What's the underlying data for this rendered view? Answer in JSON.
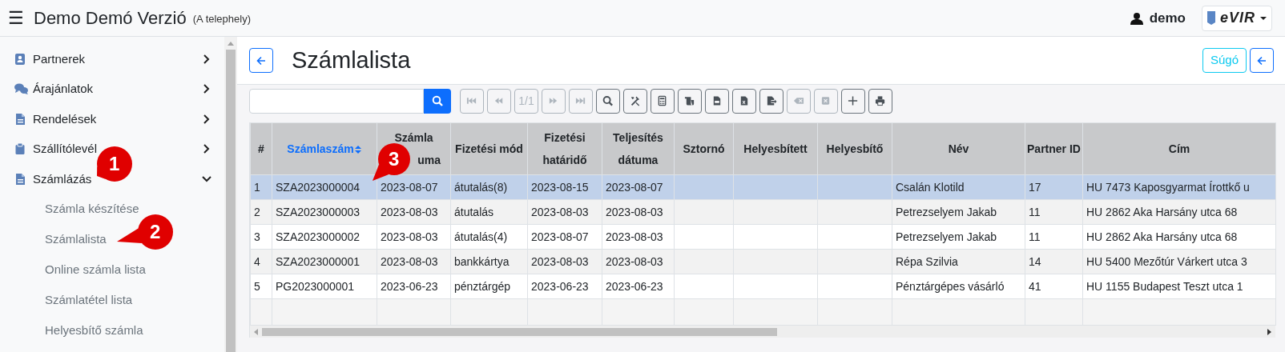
{
  "topbar": {
    "menu_glyph": "☰",
    "title": "Demo Demó Verzió",
    "subtitle": "(A telephely)",
    "user": "demo",
    "logo": "eVIR"
  },
  "sidebar": {
    "items": [
      {
        "label": "Partnerek",
        "expanded": false
      },
      {
        "label": "Árajánlatok",
        "expanded": false
      },
      {
        "label": "Rendelések",
        "expanded": false
      },
      {
        "label": "Szállítólevél",
        "expanded": false
      },
      {
        "label": "Számlázás",
        "expanded": true,
        "children": [
          {
            "label": "Számla készítése"
          },
          {
            "label": "Számlalista"
          },
          {
            "label": "Online számla lista"
          },
          {
            "label": "Számlatétel lista"
          },
          {
            "label": "Helyesbítő számla"
          }
        ]
      }
    ]
  },
  "page": {
    "title": "Számlalista",
    "help_button": "Súgó"
  },
  "toolbar": [
    {
      "kind": "first",
      "disabled": true
    },
    {
      "kind": "prev",
      "disabled": true
    },
    {
      "kind": "page",
      "label": "1/1",
      "disabled": true
    },
    {
      "kind": "next",
      "disabled": true
    },
    {
      "kind": "last",
      "disabled": true
    },
    {
      "kind": "search",
      "disabled": false
    },
    {
      "kind": "tools",
      "disabled": false
    },
    {
      "kind": "calculator",
      "disabled": false
    },
    {
      "kind": "scroll",
      "disabled": false
    },
    {
      "kind": "csv",
      "disabled": false
    },
    {
      "kind": "xls",
      "disabled": false
    },
    {
      "kind": "export",
      "disabled": false
    },
    {
      "kind": "erase",
      "disabled": true
    },
    {
      "kind": "delete",
      "disabled": true
    },
    {
      "kind": "add",
      "disabled": false
    },
    {
      "kind": "print",
      "disabled": false
    }
  ],
  "table": {
    "columns": [
      {
        "label": "#",
        "sorted": false
      },
      {
        "label": "Számlaszám",
        "sorted": true
      },
      {
        "label": "Számla",
        "label_rest": "uma",
        "sorted": false
      },
      {
        "label": "Fizetési mód",
        "sorted": false
      },
      {
        "label": "Fizetési határidő",
        "sorted": false
      },
      {
        "label": "Teljesítés dátuma",
        "sorted": false
      },
      {
        "label": "Sztornó",
        "sorted": false
      },
      {
        "label": "Helyesbített",
        "sorted": false
      },
      {
        "label": "Helyesbítő",
        "sorted": false
      },
      {
        "label": "Név",
        "sorted": false
      },
      {
        "label": "Partner ID",
        "sorted": false
      },
      {
        "label": "Cím",
        "sorted": false
      }
    ],
    "rows": [
      {
        "selected": true,
        "cells": [
          "1",
          "SZA2023000004",
          "2023-08-07",
          "átutalás(8)",
          "2023-08-15",
          "2023-08-07",
          "",
          "",
          "",
          "Csalán Klotild",
          "17",
          "HU 7473 Kaposgyarmat Írottkő u"
        ]
      },
      {
        "selected": false,
        "cells": [
          "2",
          "SZA2023000003",
          "2023-08-03",
          "átutalás",
          "2023-08-03",
          "2023-08-03",
          "",
          "",
          "",
          "Petrezselyem Jakab",
          "11",
          "HU 2862 Aka Harsány utca 68"
        ]
      },
      {
        "selected": false,
        "cells": [
          "3",
          "SZA2023000002",
          "2023-08-03",
          "átutalás(4)",
          "2023-08-07",
          "2023-08-03",
          "",
          "",
          "",
          "Petrezselyem Jakab",
          "11",
          "HU 2862 Aka Harsány utca 68"
        ]
      },
      {
        "selected": false,
        "cells": [
          "4",
          "SZA2023000001",
          "2023-08-03",
          "bankkártya",
          "2023-08-03",
          "2023-08-03",
          "",
          "",
          "",
          "Répa Szilvia",
          "14",
          "HU 5400 Mezőtúr Várkert utca 3"
        ]
      },
      {
        "selected": false,
        "cells": [
          "5",
          "PG2023000001",
          "2023-06-23",
          "pénztárgép",
          "2023-06-23",
          "2023-06-23",
          "",
          "",
          "",
          "Pénztárgépes vásárló",
          "41",
          "HU 1155 Budapest Teszt utca 1"
        ]
      }
    ]
  },
  "callouts": [
    {
      "label": "1"
    },
    {
      "label": "2"
    },
    {
      "label": "3"
    }
  ]
}
